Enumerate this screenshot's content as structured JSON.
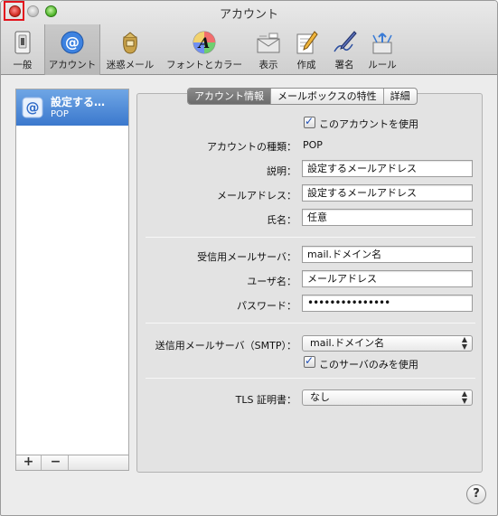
{
  "window": {
    "title": "アカウント"
  },
  "toolbar": {
    "items": [
      {
        "label": "一般",
        "icon": "general-switch-icon"
      },
      {
        "label": "アカウント",
        "icon": "at-sign-icon"
      },
      {
        "label": "迷惑メール",
        "icon": "junk-mail-bag-icon"
      },
      {
        "label": "フォントとカラー",
        "icon": "font-color-icon"
      },
      {
        "label": "表示",
        "icon": "viewing-icon"
      },
      {
        "label": "作成",
        "icon": "compose-pencil-icon"
      },
      {
        "label": "署名",
        "icon": "signature-pen-icon"
      },
      {
        "label": "ルール",
        "icon": "rules-arrows-icon"
      }
    ]
  },
  "sidebar": {
    "account": {
      "name": "設定する…",
      "type": "POP"
    },
    "add_label": "+",
    "remove_label": "−"
  },
  "tabs": [
    {
      "label": "アカウント情報",
      "selected": true
    },
    {
      "label": "メールボックスの特性",
      "selected": false
    },
    {
      "label": "詳細",
      "selected": false
    }
  ],
  "form": {
    "enable_account_label": "このアカウントを使用",
    "account_type_label": "アカウントの種類：",
    "account_type_value": "POP",
    "description_label": "説明：",
    "description_value": "設定するメールアドレス",
    "email_label": "メールアドレス：",
    "email_value": "設定するメールアドレス",
    "fullname_label": "氏名：",
    "fullname_value": "任意",
    "incoming_server_label": "受信用メールサーバ：",
    "incoming_server_value": "mail.ドメイン名",
    "username_label": "ユーザ名：",
    "username_value": "メールアドレス",
    "password_label": "パスワード：",
    "password_value": "•••••••••••••••",
    "outgoing_server_label": "送信用メールサーバ（SMTP）：",
    "outgoing_server_value": "mail.ドメイン名",
    "only_this_server_label": "このサーバのみを使用",
    "tls_label": "TLS 証明書：",
    "tls_value": "なし"
  },
  "help_label": "?",
  "colors": {
    "selection": "#3b78cd",
    "close_highlight": "#e3141d"
  }
}
